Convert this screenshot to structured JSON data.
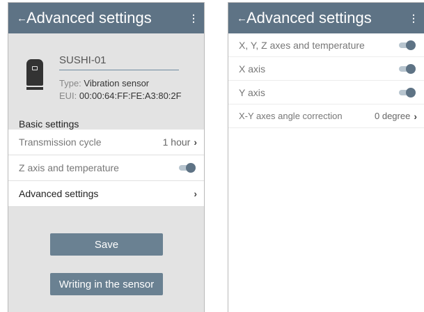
{
  "left_screen": {
    "appbar": {
      "back_icon": "←",
      "title": "Advanced settings",
      "menu_icon": "⋮"
    },
    "device": {
      "name": "SUSHI-01",
      "type_label": "Type: ",
      "type_value": "Vibration sensor",
      "eui_label": "EUI: ",
      "eui_value": "00:00:64:FF:FE:A3:80:2F"
    },
    "section_title": "Basic settings",
    "rows": [
      {
        "label": "Transmission cycle",
        "value": "1 hour",
        "chevron": "›"
      },
      {
        "label": "Z axis and temperature",
        "toggle_on": true
      },
      {
        "label": "Advanced settings",
        "chevron": "›"
      }
    ],
    "buttons": {
      "save": "Save",
      "write": "Writing in the sensor"
    }
  },
  "right_screen": {
    "appbar": {
      "back_icon": "←",
      "title": "Advanced settings",
      "menu_icon": "⋮"
    },
    "rows": [
      {
        "label": "X, Y, Z axes and temperature",
        "toggle_on": true
      },
      {
        "label": "X axis",
        "toggle_on": true
      },
      {
        "label": "Y axis",
        "toggle_on": true
      },
      {
        "label": "X-Y axes angle correction",
        "value": "0 degree",
        "chevron": "›"
      }
    ]
  },
  "colors": {
    "appbar": "#5e7385",
    "button": "#6a8192",
    "toggle_thumb": "#5e7385",
    "toggle_track": "#b8c5cf",
    "left_background": "#e3e3e3"
  }
}
